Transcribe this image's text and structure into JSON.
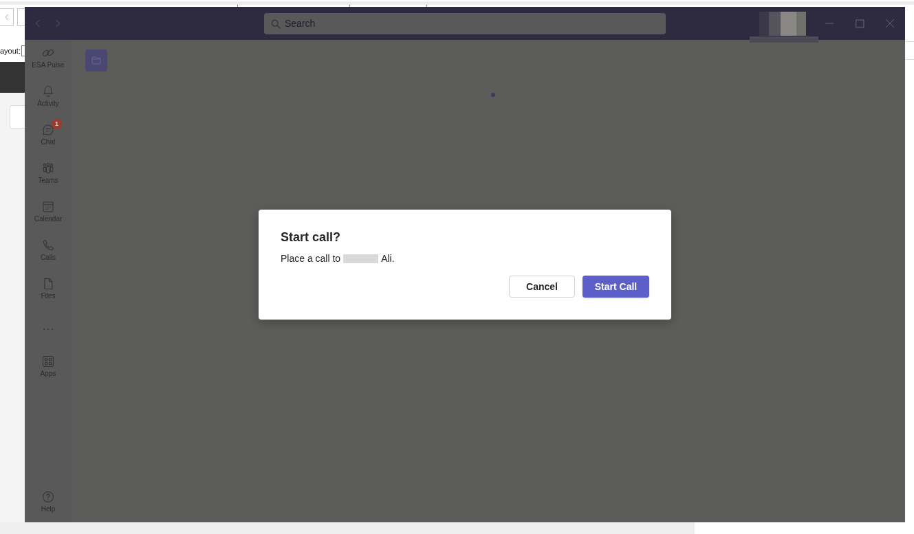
{
  "background_page": {
    "layout_label": "ayout:"
  },
  "title_bar": {
    "search": {
      "placeholder": "Search"
    }
  },
  "rail": {
    "items": [
      {
        "label": "ESA Pulse"
      },
      {
        "label": "Activity"
      },
      {
        "label": "Chat",
        "badge": "1"
      },
      {
        "label": "Teams"
      },
      {
        "label": "Calendar"
      },
      {
        "label": "Calls"
      },
      {
        "label": "Files"
      }
    ],
    "apps": {
      "label": "Apps"
    },
    "help": {
      "label": "Help"
    }
  },
  "dialog": {
    "title": "Start call?",
    "message_prefix": "Place a call to",
    "message_suffix": "Ali.",
    "buttons": [
      {
        "label": "Cancel",
        "kind": "secondary"
      },
      {
        "label": "Start Call",
        "kind": "primary"
      }
    ]
  }
}
